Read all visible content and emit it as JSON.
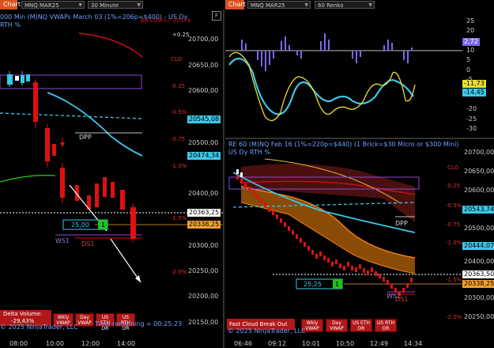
{
  "tabs": {
    "chart_left": "Chart",
    "chart_right": "Chart"
  },
  "toolbar_left": {
    "instrument": "MNQ MAR25",
    "interval": "30 Minute"
  },
  "toolbar_right": {
    "instrument": "MNQ MAR25",
    "interval": "60 Renko"
  },
  "left": {
    "header_line1": "000 Min (M)NQ VWAPs March 03 (1%=206p=$400) - US Dy",
    "header_line2": "RTH %",
    "header_red": "BB LOW+/- 20579",
    "axis": [
      "20700,00",
      "20650,00",
      "20600,00",
      "20550,00",
      "20500,00",
      "20450,00",
      "20400,00",
      "20350,00",
      "20300,00",
      "20250,00",
      "20200,00",
      "20150,00"
    ],
    "pct": [
      "+0.25",
      "CLO",
      "-0.25",
      "-0.5%",
      "-0.75",
      "-1.0%",
      "-1.5%",
      "-2.0%"
    ],
    "tags": [
      {
        "text": "20545,08",
        "color": "#3cc7e8",
        "fg": "#000"
      },
      {
        "text": "20474,34",
        "color": "#3cc7e8",
        "fg": "#000"
      },
      {
        "text": "20363,25",
        "color": "#ffffff",
        "fg": "#000"
      },
      {
        "text": "20338,25",
        "color": "#f0a030",
        "fg": "#000"
      }
    ],
    "labels": {
      "dpp": "DPP",
      "ws1": "WS1",
      "ds1": "DS1",
      "order_qty": "25,00",
      "order_count": "1"
    },
    "times": [
      "08:00",
      "10:00",
      "12:00",
      "14:00"
    ],
    "delta_title": "Delta Volume:",
    "delta_value": "-29,43%",
    "buttons": [
      "Wkly VWAP",
      "Day VWAP",
      "US ETH OR",
      "US RTH OR"
    ],
    "footer": "© 2025 NinjaTrader, LLC",
    "time_remaining": "Time remaining = 00:25:23"
  },
  "right": {
    "osc_axis": [
      "25",
      "20",
      "15",
      "10",
      "5",
      "0",
      "-5",
      "-10",
      "-15",
      "-20",
      "-25",
      "-30"
    ],
    "osc_tags": [
      {
        "text": "2,72",
        "color": "#7b68ee",
        "fg": "#fff"
      },
      {
        "text": "-11,73",
        "color": "#e8e030",
        "fg": "#000"
      },
      {
        "text": "-14,45",
        "color": "#3cc7e8",
        "fg": "#000"
      }
    ],
    "header_line1": "RE 60 (M)NQ Feb 16  (1%=220p=$440) (1 Brick=$30 Micro or $300 Mini)",
    "header_line2": "US Dy RTH %",
    "axis": [
      "20700,00",
      "20650,00",
      "20600,00",
      "20550,00",
      "20500,00",
      "20450,00",
      "20400,00",
      "20350,00",
      "20300,00",
      "20250,00"
    ],
    "pct": [
      "CLO",
      "-0.25",
      "-0.5%",
      "-0.75",
      "-1.0%",
      "-1.5%",
      "-2.0%"
    ],
    "tags": [
      {
        "text": "20543,74",
        "color": "#3cc7e8",
        "fg": "#000"
      },
      {
        "text": "20444,07",
        "color": "#3cc7e8",
        "fg": "#000"
      },
      {
        "text": "20363,50",
        "color": "#ffffff",
        "fg": "#000"
      },
      {
        "text": "20338,25",
        "color": "#f0a030",
        "fg": "#000"
      }
    ],
    "labels": {
      "dpp": "DPP",
      "ws1": "WS1",
      "ds1": "DS1",
      "order_qty": "25,25",
      "order_count": "1"
    },
    "times": [
      "06:46",
      "09:12",
      "10:01",
      "10:50",
      "12:49",
      "14:34"
    ],
    "fast_cloud": "Fast Cloud Break Out",
    "buttons": [
      "Wkly VWAP",
      "Day VWAP",
      "US ETH OR",
      "US RTH OR"
    ],
    "footer": "© 2025 NinjaTrader, LLC"
  }
}
